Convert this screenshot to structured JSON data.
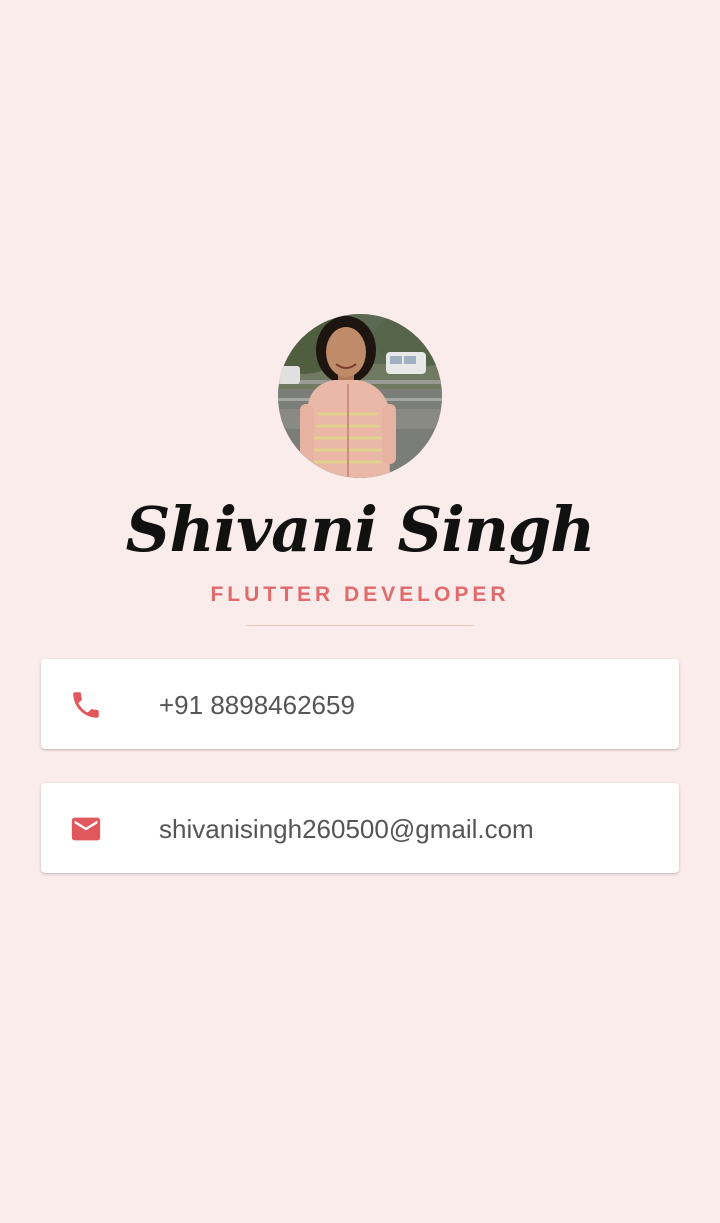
{
  "profile": {
    "name": "Shivani Singh",
    "title": "FLUTTER DEVELOPER",
    "avatar_icon": "profile-photo"
  },
  "contacts": [
    {
      "icon": "phone-icon",
      "value": "+91 8898462659"
    },
    {
      "icon": "mail-icon",
      "value": "shivanisingh260500@gmail.com"
    }
  ],
  "colors": {
    "background": "#fbecec",
    "accent": "#e06a6c",
    "name": "#111111",
    "card": "#ffffff",
    "card_text": "#555555"
  }
}
